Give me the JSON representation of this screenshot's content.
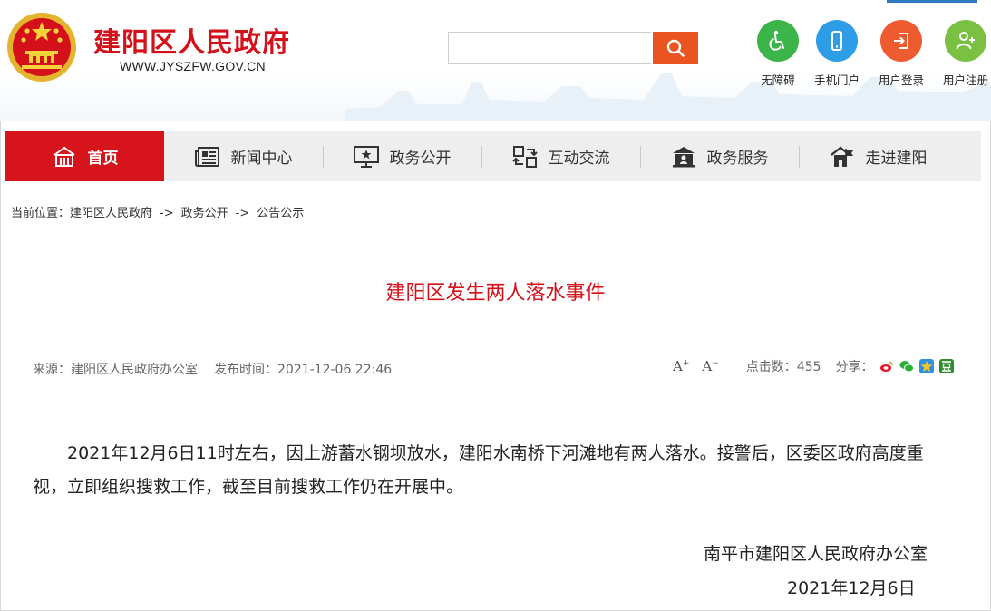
{
  "header": {
    "site_name": "建阳区人民政府",
    "site_url": "WWW.JYSZFW.GOV.CN",
    "search_placeholder": "",
    "tools": [
      {
        "label": "无障碍",
        "icon": "wheelchair-icon",
        "color": "#3bb54a"
      },
      {
        "label": "手机门户",
        "icon": "mobile-icon",
        "color": "#2c9de6"
      },
      {
        "label": "用户登录",
        "icon": "login-icon",
        "color": "#ef5b30"
      },
      {
        "label": "用户注册",
        "icon": "user-add-icon",
        "color": "#7ac143"
      }
    ]
  },
  "nav": {
    "items": [
      {
        "label": "首页",
        "icon": "home-icon",
        "active": true
      },
      {
        "label": "新闻中心",
        "icon": "newspaper-icon"
      },
      {
        "label": "政务公开",
        "icon": "board-icon"
      },
      {
        "label": "互动交流",
        "icon": "exchange-icon"
      },
      {
        "label": "政务服务",
        "icon": "service-icon"
      },
      {
        "label": "走进建阳",
        "icon": "building-icon"
      }
    ]
  },
  "breadcrumb": {
    "prefix": "当前位置：",
    "items": [
      "建阳区人民政府",
      "政务公开",
      "公告公示"
    ],
    "separator": "->"
  },
  "article": {
    "title": "建阳区发生两人落水事件",
    "source": "来源：建阳区人民政府办公室",
    "published": "发布时间：2021-12-06 22:46",
    "font_increase": "A",
    "font_decrease": "A",
    "views": "点击数：455",
    "share_label": "分享：",
    "body": "2021年12月6日11时左右，因上游蓄水钢坝放水，建阳水南桥下河滩地有两人落水。接警后，区委区政府高度重视，立即组织搜救工作，截至目前搜救工作仍在开展中。",
    "signature": "南平市建阳区人民政府办公室",
    "date": "2021年12月6日"
  },
  "colors": {
    "brand_red": "#d4101a",
    "nav_active": "#d7141b",
    "search_button": "#ea5420"
  }
}
